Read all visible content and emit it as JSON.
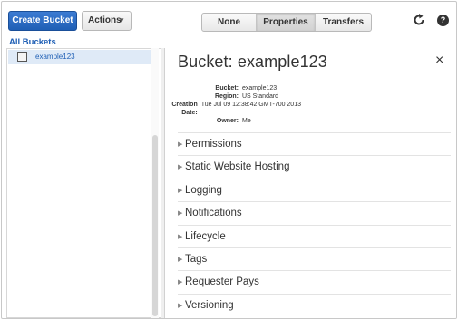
{
  "toolbar": {
    "create_label": "Create Bucket",
    "actions_label": "Actions",
    "view_tabs": [
      "None",
      "Properties",
      "Transfers"
    ],
    "selected_tab": "Properties",
    "help_label": "?"
  },
  "buckets": {
    "heading": "All Buckets",
    "items": [
      {
        "name": "example123",
        "selected": true
      }
    ]
  },
  "details": {
    "title": "Bucket: example123",
    "close_label": "×",
    "meta": [
      {
        "key": "Bucket:",
        "value": "example123"
      },
      {
        "key": "Region:",
        "value": "US Standard"
      },
      {
        "key": "Creation Date:",
        "value": "Tue Jul 09 12:38:42 GMT-700 2013"
      },
      {
        "key": "Owner:",
        "value": "Me"
      }
    ],
    "sections": [
      "Permissions",
      "Static Website Hosting",
      "Logging",
      "Notifications",
      "Lifecycle",
      "Tags",
      "Requester Pays",
      "Versioning"
    ]
  },
  "colors": {
    "accent": "#1f5fb5",
    "selected_row": "#dfeaf7"
  },
  "icons": [
    "chevron-down-icon",
    "refresh-icon",
    "help-icon",
    "bucket-icon",
    "close-icon",
    "triangle-right-icon"
  ]
}
